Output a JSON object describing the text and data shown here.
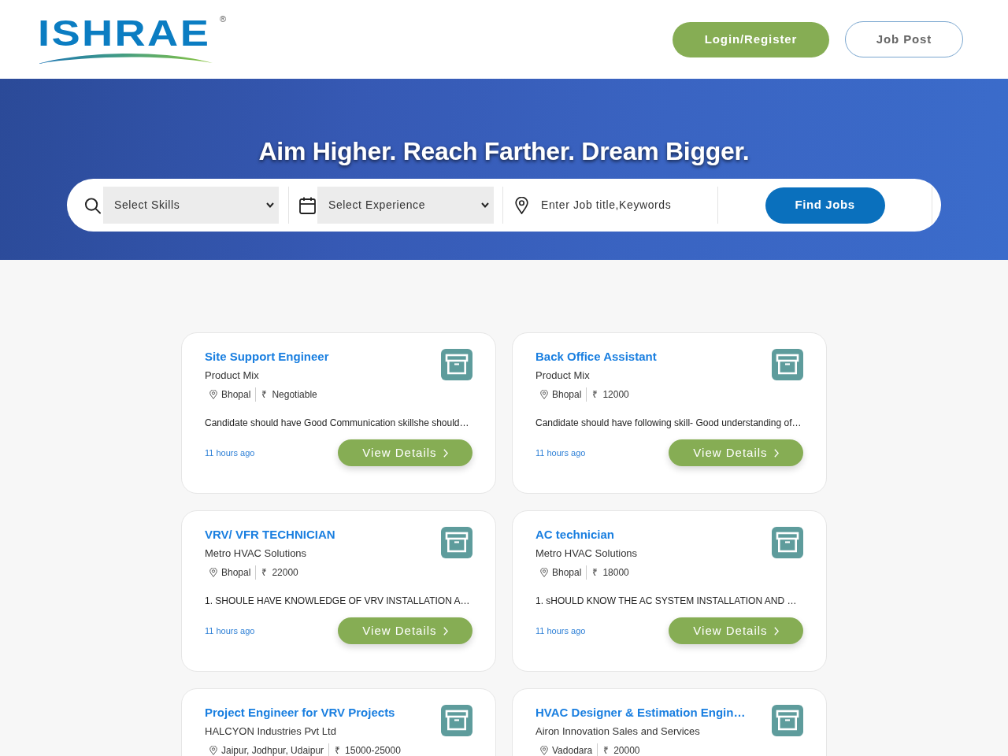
{
  "header": {
    "logo": {
      "wordmark": "ISHRAE",
      "registered": "®"
    },
    "buttons": [
      {
        "label": "Login/Register",
        "kind": "filled"
      },
      {
        "label": "Job Post",
        "kind": "outline"
      }
    ]
  },
  "hero": {
    "headline": "Aim Higher. Reach Farther. Dream Bigger.",
    "search": {
      "fields": [
        {
          "kind": "skills",
          "placeholder": "Select Skills"
        },
        {
          "kind": "experience",
          "placeholder": "Select Experience"
        },
        {
          "kind": "keywords",
          "placeholder": "Enter Job title,Keywords"
        }
      ],
      "button": "Find Jobs"
    }
  },
  "jobs": [
    {
      "title": "Site Support Engineer",
      "company": "Product Mix",
      "location": "Bhopal",
      "currency": "₹",
      "salary": "Negotiable",
      "description": "Candidate should have Good Communication skillshe should…",
      "posted": "11 hours ago",
      "action": "View Details"
    },
    {
      "title": "Back Office Assistant",
      "company": "Product Mix",
      "location": "Bhopal",
      "currency": "₹",
      "salary": "12000",
      "description": "Candidate should have following skill- Good understanding of…",
      "posted": "11 hours ago",
      "action": "View Details"
    },
    {
      "title": "VRV/ VFR TECHNICIAN",
      "company": "Metro HVAC Solutions",
      "location": "Bhopal",
      "currency": "₹",
      "salary": "22000",
      "description": "1. SHOULE HAVE KNOWLEDGE OF VRV INSTALLATION A…",
      "posted": "11 hours ago",
      "action": "View Details"
    },
    {
      "title": "AC technician",
      "company": "Metro HVAC Solutions",
      "location": "Bhopal",
      "currency": "₹",
      "salary": "18000",
      "description": "1. sHOULD KNOW THE AC SYSTEM INSTALLATION AND …",
      "posted": "11 hours ago",
      "action": "View Details"
    },
    {
      "title": "Project Engineer for VRV Projects",
      "company": "HALCYON Industries Pvt Ltd",
      "location": "Jaipur, Jodhpur, Udaipur",
      "currency": "₹",
      "salary": "15000-25000"
    },
    {
      "title": "HVAC Designer & Estimation Engin…",
      "company": "Airon Innovation Sales and Services",
      "location": "Vadodara",
      "currency": "₹",
      "salary": "20000"
    }
  ]
}
